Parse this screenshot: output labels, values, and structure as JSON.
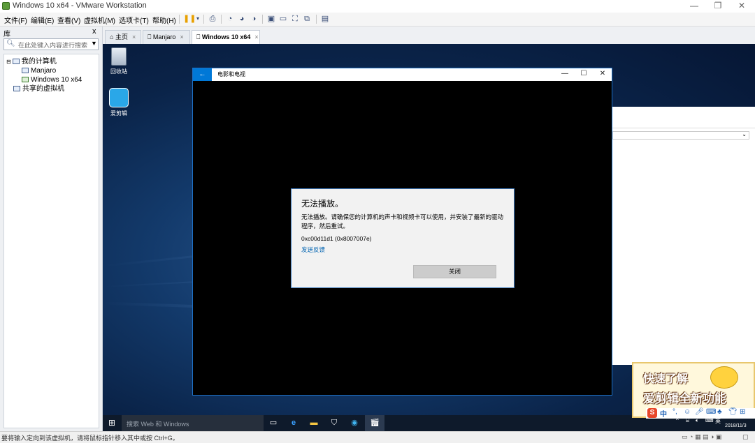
{
  "window": {
    "title": "Windows 10 x64 - VMware Workstation",
    "controls": [
      "—",
      "❐",
      "✕"
    ]
  },
  "menu": [
    "文件(F)",
    "编辑(E)",
    "查看(V)",
    "虚拟机(M)",
    "选项卡(T)",
    "帮助(H)"
  ],
  "library": {
    "title": "库",
    "close": "x",
    "search_placeholder": "在此处键入内容进行搜索",
    "tree": [
      {
        "label": "我的计算机"
      },
      {
        "label": "Manjaro"
      },
      {
        "label": "Windows 10 x64"
      },
      {
        "label": "共享的虚拟机"
      }
    ]
  },
  "tabs": [
    {
      "label": "主页",
      "close": "×"
    },
    {
      "label": "Manjaro",
      "close": "×"
    },
    {
      "label": "Windows 10 x64",
      "close": "×"
    }
  ],
  "desktop": {
    "icons": [
      "回收站",
      "爱剪辑"
    ]
  },
  "movies_app": {
    "title": "电影和电视",
    "back": "←",
    "controls": [
      "—",
      "☐",
      "✕"
    ],
    "dialog": {
      "title": "无法播放。",
      "message": "无法播放。请确保您的计算机的声卡和视频卡可以使用，并安装了最新的驱动程序，然后重试。",
      "code": "0xc00d11d1 (0x8007007e)",
      "feedback_link": "发送反馈",
      "close_button": "关闭"
    }
  },
  "taskbar": {
    "search_placeholder": "搜索 Web 和 Windows",
    "date": "2018/11/3",
    "language": "英"
  },
  "ad": {
    "line1": "快速了解",
    "line2": "爱剪辑全新功能"
  },
  "statusbar": {
    "text": "要将输入定向到该虚拟机，请将鼠标指针移入其中或按 Ctrl+G。"
  }
}
